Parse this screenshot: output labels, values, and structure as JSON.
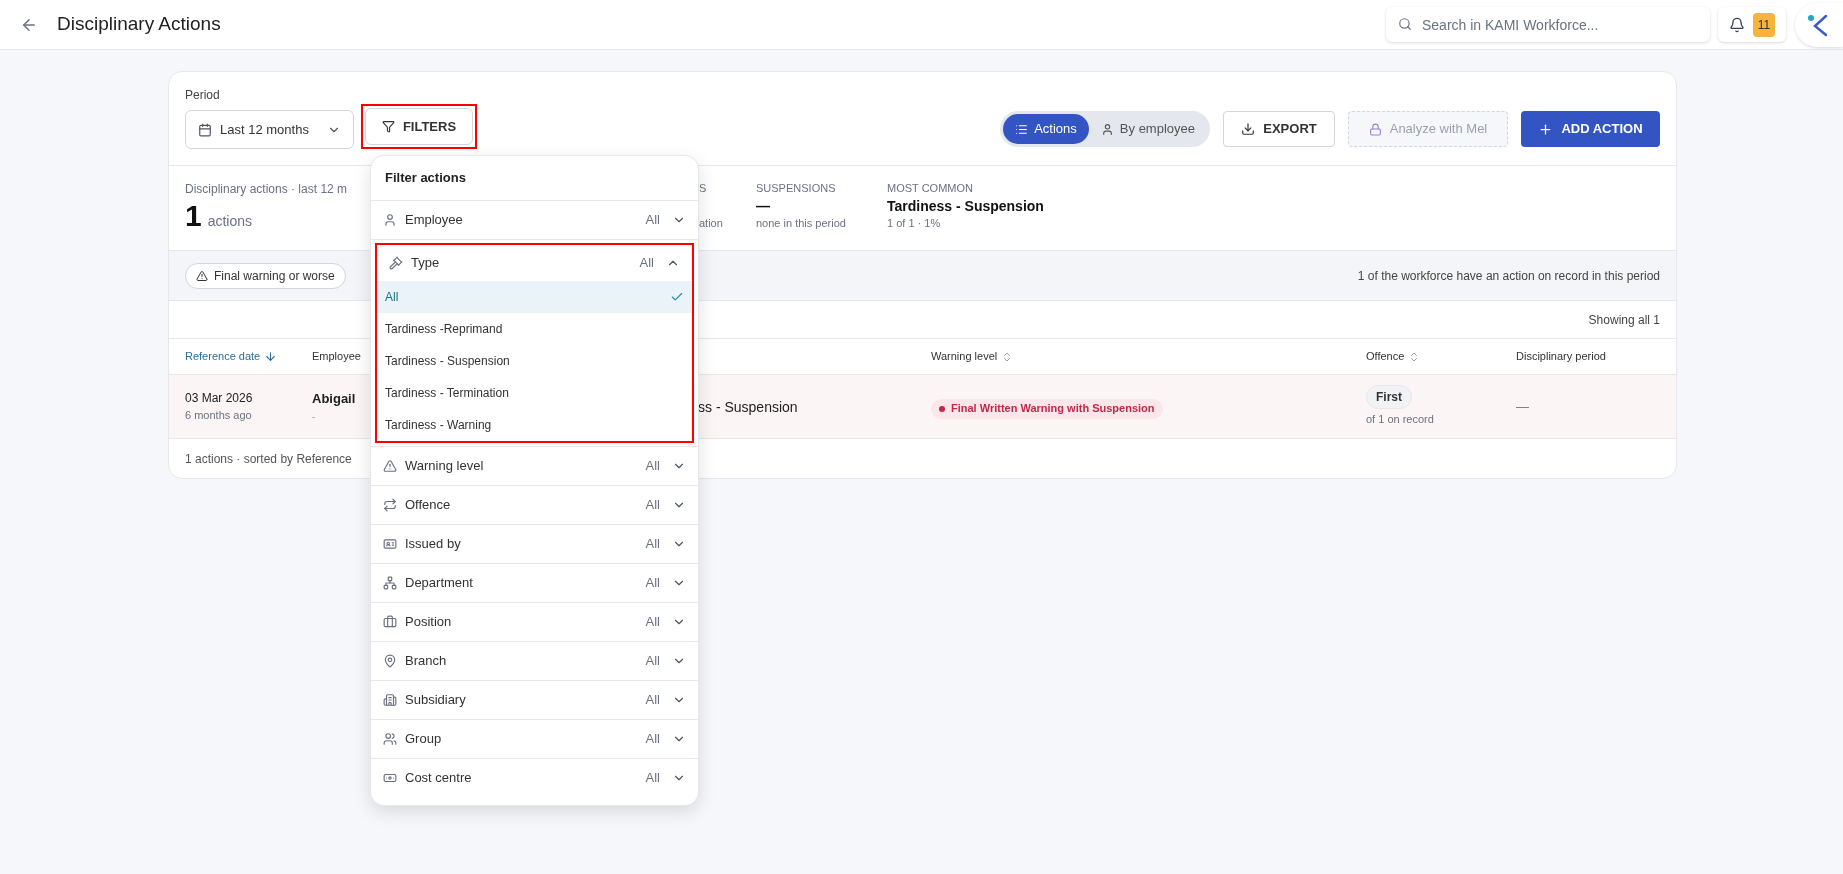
{
  "header": {
    "title": "Disciplinary Actions",
    "search": {
      "placeholder": "Search in KAMI Workforce..."
    },
    "notifications": {
      "count": "11"
    }
  },
  "toolbar": {
    "period_label": "Period",
    "period_value": "Last 12 months",
    "filters_button": {
      "label": "FILTERS",
      "highlighted": true
    },
    "view_toggle": [
      {
        "label": "Actions",
        "selected": true
      },
      {
        "label": "By employee",
        "selected": false
      }
    ],
    "export_button": "EXPORT",
    "analyze_button": {
      "label": "Analyze with Mel",
      "disabled": true
    },
    "add_button": "ADD ACTION"
  },
  "stats": {
    "caption": "Disciplinary actions · last 12 m",
    "count": "1",
    "unit": "actions",
    "column_2": {
      "label": "S",
      "note": "ation"
    },
    "suspensions": {
      "label": "SUSPENSIONS",
      "value": "—",
      "note": "none in this period"
    },
    "most_common": {
      "label": "MOST COMMON",
      "value": "Tardiness - Suspension",
      "note": "1 of 1 · 1%"
    }
  },
  "chips": [
    {
      "label": "Final warning or worse"
    }
  ],
  "workforce_note": "1 of the workforce have an action on record in this period",
  "showing": "Showing all 1",
  "table": {
    "columns": [
      {
        "label": "Reference date",
        "sorted": true
      },
      {
        "label": "Employee",
        "sorted": false,
        "sortable": false
      },
      {
        "label": "Warning level",
        "sorted": false,
        "sortable": true
      },
      {
        "label": "Offence",
        "sorted": false,
        "sortable": true
      },
      {
        "label": "Disciplinary period",
        "sorted": false,
        "sortable": false
      }
    ],
    "rows": [
      {
        "date": "03 Mar 2026",
        "ago": "6 months ago",
        "employee": "Abigail",
        "employee_note": "-",
        "type": "ss - Suspension",
        "warning": "Final Written Warning with Suspension",
        "offence": "First",
        "offence_note": "of 1 on record",
        "period": "—"
      }
    ]
  },
  "footer": "1 actions · sorted by Reference",
  "filter_menu": {
    "title": "Filter actions",
    "filters": [
      {
        "label": "Employee",
        "value": "All",
        "expanded": false,
        "highlighted": false
      },
      {
        "label": "Type",
        "value": "All",
        "expanded": true,
        "highlighted": true,
        "options": [
          {
            "label": "All",
            "selected": true
          },
          {
            "label": "Tardiness -Reprimand",
            "selected": false
          },
          {
            "label": "Tardiness - Suspension",
            "selected": false
          },
          {
            "label": "Tardiness - Termination",
            "selected": false
          },
          {
            "label": "Tardiness - Warning",
            "selected": false
          }
        ]
      },
      {
        "label": "Warning level",
        "value": "All",
        "expanded": false,
        "highlighted": false
      },
      {
        "label": "Offence",
        "value": "All",
        "expanded": false,
        "highlighted": false
      },
      {
        "label": "Issued by",
        "value": "All",
        "expanded": false,
        "highlighted": false
      },
      {
        "label": "Department",
        "value": "All",
        "expanded": false,
        "highlighted": false
      },
      {
        "label": "Position",
        "value": "All",
        "expanded": false,
        "highlighted": false
      },
      {
        "label": "Branch",
        "value": "All",
        "expanded": false,
        "highlighted": false
      },
      {
        "label": "Subsidiary",
        "value": "All",
        "expanded": false,
        "highlighted": false
      },
      {
        "label": "Group",
        "value": "All",
        "expanded": false,
        "highlighted": false
      },
      {
        "label": "Cost centre",
        "value": "All",
        "expanded": false,
        "highlighted": false
      }
    ]
  }
}
